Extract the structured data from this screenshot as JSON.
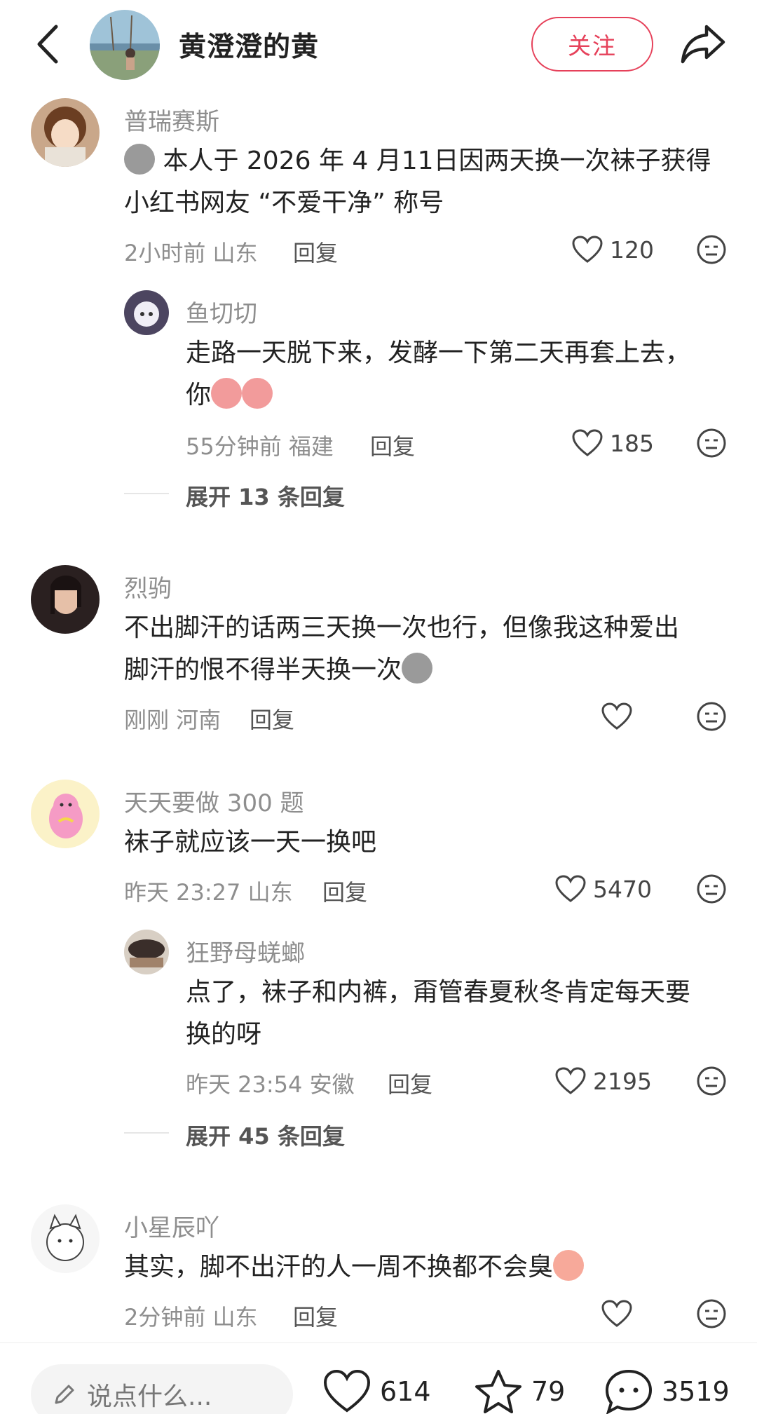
{
  "header": {
    "author_name": "黄澄澄的黄",
    "follow_label": "关注"
  },
  "comments": [
    {
      "user": "普瑞赛斯",
      "text_line1": "本人于 2026 年 4 月11日因两天换一次袜子获得",
      "text_line2": "小红书网友 “不爱干净” 称号",
      "time_location": "2小时前 山东",
      "reply_label": "回复",
      "likes": "120"
    },
    {
      "user": "鱼切切",
      "text_line1": "走路一天脱下来，发酵一下第二天再套上去，",
      "text_line2": "你",
      "time_location": "55分钟前 福建",
      "reply_label": "回复",
      "likes": "185"
    },
    {
      "user": "烈驹",
      "text_line1": "不出脚汗的话两三天换一次也行，但像我这种爱出",
      "text_line2": "脚汗的恨不得半天换一次",
      "time_location": "刚刚 河南",
      "reply_label": "回复",
      "likes": ""
    },
    {
      "user": "天天要做 300 题",
      "text_line1": "袜子就应该一天一换吧",
      "time_location": "昨天 23:27 山东",
      "reply_label": "回复",
      "likes": "5470"
    },
    {
      "user": "狂野母蜣螂",
      "text_line1": "点了，袜子和内裤，甭管春夏秋冬肯定每天要",
      "text_line2": "换的呀",
      "time_location": "昨天 23:54 安徽",
      "reply_label": "回复",
      "likes": "2195"
    },
    {
      "user": "小星辰吖",
      "text_line1": "其实，脚不出汗的人一周不换都不会臭",
      "time_location": "2分钟前 山东",
      "reply_label": "回复",
      "likes": ""
    }
  ],
  "expand": [
    {
      "label": "展开 13 条回复"
    },
    {
      "label": "展开 45 条回复"
    }
  ],
  "bottom_bar": {
    "input_placeholder": "说点什么...",
    "likes": "614",
    "stars": "79",
    "comments": "3519"
  }
}
